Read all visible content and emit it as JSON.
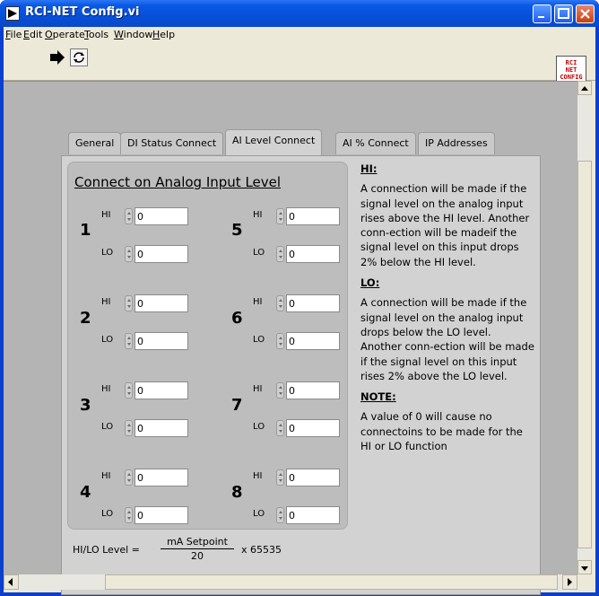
{
  "window": {
    "title": "RCI-NET Config.vi"
  },
  "menu": [
    "File",
    "Edit",
    "Operate",
    "Tools",
    "Window",
    "Help"
  ],
  "vi_icon": {
    "line1": "RCI",
    "line2": "NET",
    "line3": "CONFIG"
  },
  "tabs": [
    {
      "label": "General",
      "active": false
    },
    {
      "label": "DI Status Connect",
      "active": false
    },
    {
      "label": "AI Level Connect",
      "active": true
    },
    {
      "label": "AI % Connect",
      "active": false
    },
    {
      "label": "IP Addresses",
      "active": false
    }
  ],
  "section_title": "Connect on Analog Input Level",
  "labels": {
    "hi": "HI",
    "lo": "LO"
  },
  "channels": [
    {
      "num": "1",
      "hi": "0",
      "lo": "0"
    },
    {
      "num": "2",
      "hi": "0",
      "lo": "0"
    },
    {
      "num": "3",
      "hi": "0",
      "lo": "0"
    },
    {
      "num": "4",
      "hi": "0",
      "lo": "0"
    },
    {
      "num": "5",
      "hi": "0",
      "lo": "0"
    },
    {
      "num": "6",
      "hi": "0",
      "lo": "0"
    },
    {
      "num": "7",
      "hi": "0",
      "lo": "0"
    },
    {
      "num": "8",
      "hi": "0",
      "lo": "0"
    }
  ],
  "formula": {
    "lhs": "HI/LO Level  =",
    "numerator": "mA Setpoint",
    "denominator": "20",
    "rhs": "x 65535"
  },
  "help": {
    "hi_title": "HI:",
    "hi_text": "A connection will be made if the signal level on the analog input rises above the HI level. Another conn-ection will be madeif the signal level on this input drops 2% below the HI level.",
    "lo_title": "LO:",
    "lo_text": "A connection will be made if the signal level on the analog input drops below the LO level. Another conn-ection will be made if the signal level on this input rises 2% above the LO level.",
    "note_title": "NOTE:",
    "note_text": "A value of 0 will cause no connectoins to be made for the HI or LO function"
  },
  "colors": {
    "titlebar": "#0b58e6",
    "panel_bg": "#b4b4b4",
    "tab_bg": "#d2d2d2"
  }
}
